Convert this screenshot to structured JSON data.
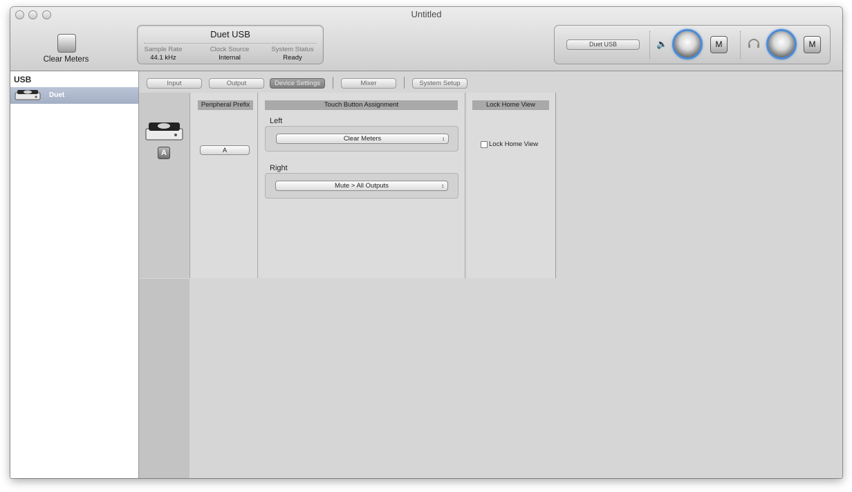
{
  "window": {
    "title": "Untitled"
  },
  "toolbar": {
    "clear_meters_label": "Clear Meters"
  },
  "status_display": {
    "device_name": "Duet USB",
    "fields": [
      {
        "label": "Sample Rate",
        "value": "44.1 kHz"
      },
      {
        "label": "Clock Source",
        "value": "Internal"
      },
      {
        "label": "System Status",
        "value": "Ready"
      }
    ]
  },
  "monitor": {
    "device_select": "Duet USB",
    "speaker_mute_label": "M",
    "headphone_mute_label": "M",
    "accent_color": "#4a8cd6"
  },
  "sidebar": {
    "header": "USB",
    "items": [
      {
        "label": "Duet",
        "selected": true
      }
    ]
  },
  "tabs": [
    {
      "label": "Input",
      "active": false
    },
    {
      "label": "Output",
      "active": false
    },
    {
      "label": "Device Settings",
      "active": true
    },
    {
      "label": "Mixer",
      "active": false
    },
    {
      "label": "System Setup",
      "active": false
    }
  ],
  "device_settings": {
    "device_badge": "A",
    "peripheral_prefix": {
      "header": "Peripheral Prefix",
      "value": "A"
    },
    "touch_button": {
      "header": "Touch Button Assignment",
      "left_label": "Left",
      "left_value": "Clear Meters",
      "right_label": "Right",
      "right_value": "Mute > All Outputs"
    },
    "lock_home": {
      "header": "Lock Home View",
      "checkbox_label": "Lock Home View",
      "checked": false
    }
  }
}
